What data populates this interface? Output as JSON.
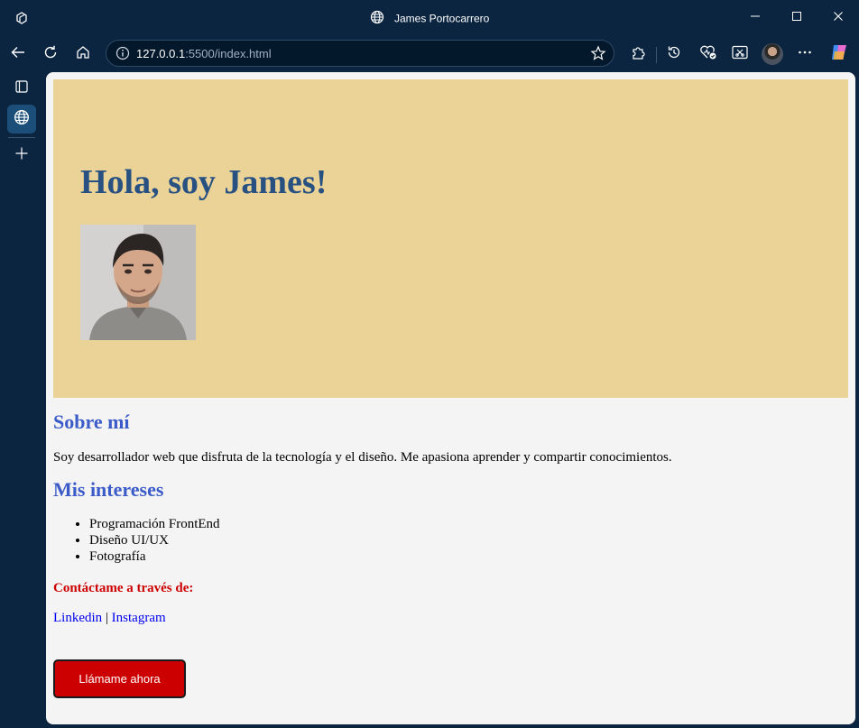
{
  "browser": {
    "window_title": "James Portocarrero",
    "url_host": "127.0.0.1",
    "url_rest": ":5500/index.html"
  },
  "page": {
    "hero_title": "Hola, soy James!",
    "about_heading": "Sobre mí",
    "about_text": "Soy desarrollador web que disfruta de la tecnología y el diseño. Me apasiona aprender y compartir conocimientos.",
    "interests_heading": "Mis intereses",
    "interests": [
      "Programación FrontEnd",
      "Diseño UI/UX",
      "Fotografía"
    ],
    "contact_heading": "Contáctame a través de:",
    "links": {
      "linkedin": "Linkedin",
      "separator": "|",
      "instagram": "Instagram"
    },
    "cta_label": "Llámame ahora"
  },
  "colors": {
    "hero_bg": "#ebd397",
    "hero_title": "#285182",
    "section_heading": "#3b5bc8",
    "contact_heading": "#cc0000",
    "cta_bg": "#cc0000",
    "link": "#0000ee",
    "browser_chrome": "#0b2540"
  },
  "icons": [
    "workspaces-icon",
    "globe-icon",
    "minimize-icon",
    "maximize-icon",
    "close-icon",
    "back-icon",
    "refresh-icon",
    "home-icon",
    "info-icon",
    "favorite-star-icon",
    "extensions-icon",
    "history-icon",
    "browser-essentials-icon",
    "screenshot-icon",
    "more-icon",
    "copilot-icon",
    "tab-actions-icon",
    "new-tab-icon"
  ]
}
